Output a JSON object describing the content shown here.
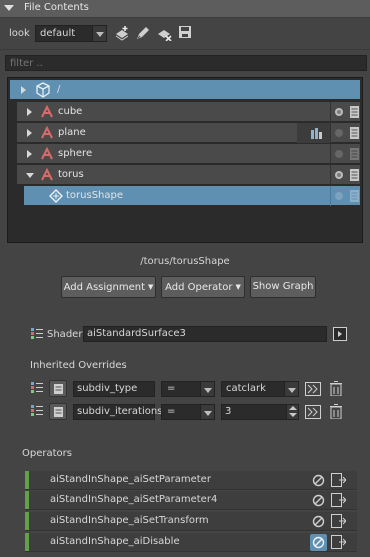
{
  "panel": {
    "title": "File Contents"
  },
  "toolbar": {
    "look_label": "look",
    "look_value": "default"
  },
  "filter": {
    "placeholder": "filter .."
  },
  "tree": {
    "root_label": "/",
    "items": [
      {
        "label": "cube"
      },
      {
        "label": "plane"
      },
      {
        "label": "sphere"
      },
      {
        "label": "torus"
      },
      {
        "label": "torusShape"
      }
    ]
  },
  "path": "/torus/torusShape",
  "actions": {
    "add_assignment": "Add Assignment",
    "add_operator": "Add Operator",
    "show_graph": "Show Graph"
  },
  "shader": {
    "label": "Shader",
    "value": "aiStandardSurface3"
  },
  "overrides": {
    "title": "Inherited Overrides",
    "rows": [
      {
        "name": "subdiv_type",
        "op": "=",
        "value": "catclark"
      },
      {
        "name": "subdiv_iterations",
        "op": "=",
        "value": "3"
      }
    ]
  },
  "operators": {
    "title": "Operators",
    "items": [
      {
        "label": "aiStandInShape_aiSetParameter"
      },
      {
        "label": "aiStandInShape_aiSetParameter4"
      },
      {
        "label": "aiStandInShape_aiSetTransform"
      },
      {
        "label": "aiStandInShape_aiDisable"
      }
    ]
  },
  "colors": {
    "selection": "#5f8fb1",
    "operator_bar": "#62a04a",
    "panel_bg": "#444444"
  }
}
